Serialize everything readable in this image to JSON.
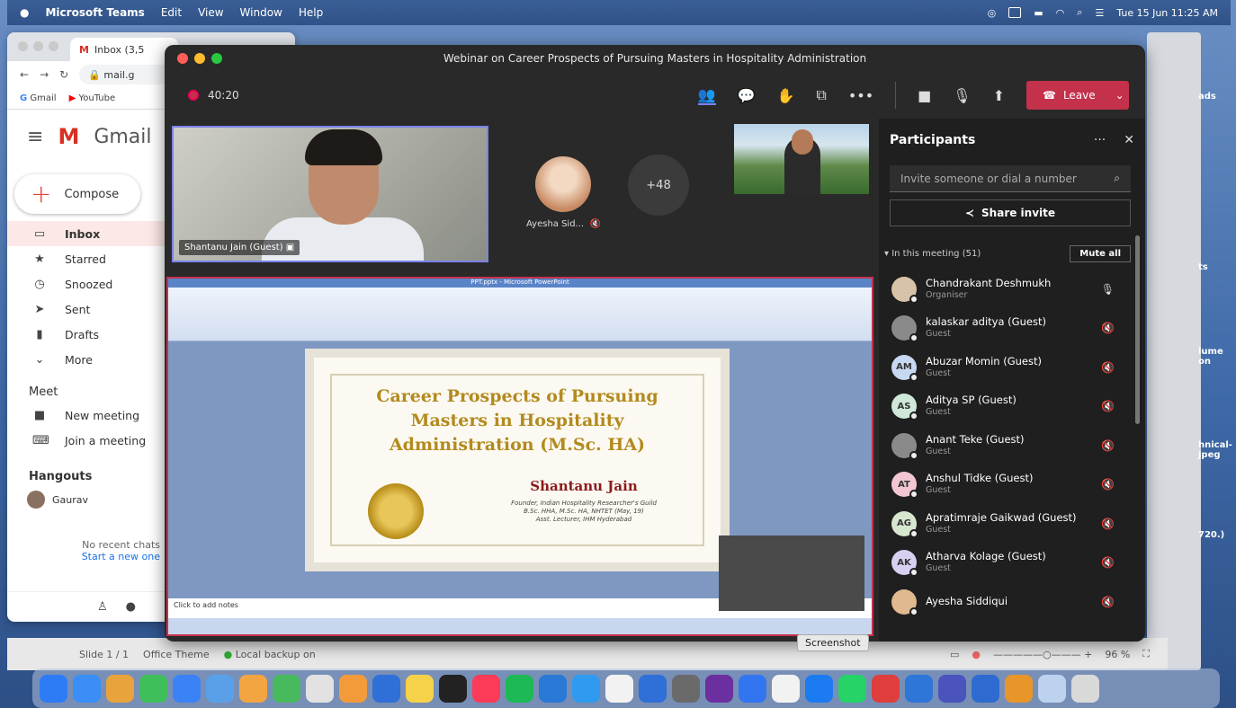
{
  "menubar": {
    "apple": "",
    "app": "Microsoft Teams",
    "items": [
      "Edit",
      "View",
      "Window",
      "Help"
    ],
    "clock": "Tue 15 Jun  11:25 AM"
  },
  "chrome": {
    "tab_title": "Inbox (3,5",
    "url": "mail.g",
    "bookmarks": [
      "Gmail",
      "YouTube"
    ],
    "gmail_label": "Gmail",
    "compose": "Compose",
    "nav": [
      {
        "icon": "inbox-icon",
        "glyph": "▭",
        "label": "Inbox"
      },
      {
        "icon": "star-icon",
        "glyph": "★",
        "label": "Starred"
      },
      {
        "icon": "clock-icon",
        "glyph": "◷",
        "label": "Snoozed"
      },
      {
        "icon": "send-icon",
        "glyph": "➤",
        "label": "Sent"
      },
      {
        "icon": "draft-icon",
        "glyph": "▮",
        "label": "Drafts"
      },
      {
        "icon": "chevron-down-icon",
        "glyph": "⌄",
        "label": "More"
      }
    ],
    "meet_heading": "Meet",
    "meet_items": [
      {
        "icon": "video-icon",
        "glyph": "■",
        "label": "New meeting"
      },
      {
        "icon": "keyboard-icon",
        "glyph": "⌨",
        "label": "Join a meeting"
      }
    ],
    "hangouts_heading": "Hangouts",
    "hangouts_user": "Gaurav",
    "no_chats": "No recent chats",
    "start_chat": "Start a new one"
  },
  "desktop_labels": [
    "ads",
    "ts",
    "lume\non",
    "hnical-\njpeg",
    "720.)"
  ],
  "finder_bar": {
    "slide": "Slide 1 / 1",
    "theme": "Office Theme",
    "backup": "Local backup on",
    "zoom": "96 %"
  },
  "teams": {
    "title": "Webinar on Career Prospects of Pursuing Masters in Hospitality Administration",
    "timer": "40:20",
    "leave": "Leave",
    "video_main_name": "Shantanu Jain (Guest)",
    "avatar_name": "Ayesha Sid...",
    "more_count": "+48",
    "ppt_window_title": "PPT.pptx - Microsoft PowerPoint",
    "slide": {
      "title_lines": [
        "Career Prospects of Pursuing",
        "Masters in Hospitality",
        "Administration (M.Sc. HA)"
      ],
      "name": "Shantanu Jain",
      "subtitle": "Founder, Indian Hospitality Researcher's Guild\nB.Sc. HHA, M.Sc. HA, NHTET (May, 19)\nAsst. Lecturer, IHM Hyderabad"
    },
    "notes_placeholder": "Click to add notes"
  },
  "participants": {
    "heading": "Participants",
    "search_placeholder": "Invite someone or dial a number",
    "share_invite": "Share invite",
    "in_meeting": "In this meeting (51)",
    "mute_all": "Mute all",
    "list": [
      {
        "name": "Chandrakant Deshmukh",
        "role": "Organiser",
        "initials": "",
        "color": "#d9c3a8",
        "muted": false
      },
      {
        "name": "kalaskar aditya (Guest)",
        "role": "Guest",
        "initials": "",
        "color": "#8a8a8a",
        "muted": true
      },
      {
        "name": "Abuzar Momin (Guest)",
        "role": "Guest",
        "initials": "AM",
        "color": "#c7d9f2",
        "muted": true
      },
      {
        "name": "Aditya SP (Guest)",
        "role": "Guest",
        "initials": "AS",
        "color": "#cfe8d9",
        "muted": true
      },
      {
        "name": "Anant Teke (Guest)",
        "role": "Guest",
        "initials": "",
        "color": "#8a8a8a",
        "muted": true
      },
      {
        "name": "Anshul Tidke (Guest)",
        "role": "Guest",
        "initials": "AT",
        "color": "#f2c7d2",
        "muted": true
      },
      {
        "name": "Apratimraje Gaikwad (Guest)",
        "role": "Guest",
        "initials": "AG",
        "color": "#d6e6cf",
        "muted": true
      },
      {
        "name": "Atharva Kolage (Guest)",
        "role": "Guest",
        "initials": "AK",
        "color": "#d7d0f0",
        "muted": true
      },
      {
        "name": "Ayesha Siddiqui",
        "role": "",
        "initials": "",
        "color": "#e0b98f",
        "muted": true
      }
    ]
  },
  "tooltip": "Screenshot",
  "dock": [
    "#2d7cf6",
    "#3a8ef5",
    "#e8a33c",
    "#3fbf5a",
    "#3b82f6",
    "#5aa0e8",
    "#f2a541",
    "#48b85c",
    "#e2e2e2",
    "#f39a3a",
    "#2f6fd8",
    "#f5d24a",
    "#222222",
    "#fb3b57",
    "#1db954",
    "#2b79d6",
    "#2e9bf0",
    "#f2f2f2",
    "#2f6fd8",
    "#6a6a6a",
    "#6b2fa0",
    "#3176f0",
    "#f2f2f2",
    "#1d7bf2",
    "#25d366",
    "#e03d3d",
    "#2e76d8",
    "#4b53bc",
    "#2e6bd0",
    "#e8962a",
    "#bcd2ee",
    "#d9d9d9"
  ]
}
